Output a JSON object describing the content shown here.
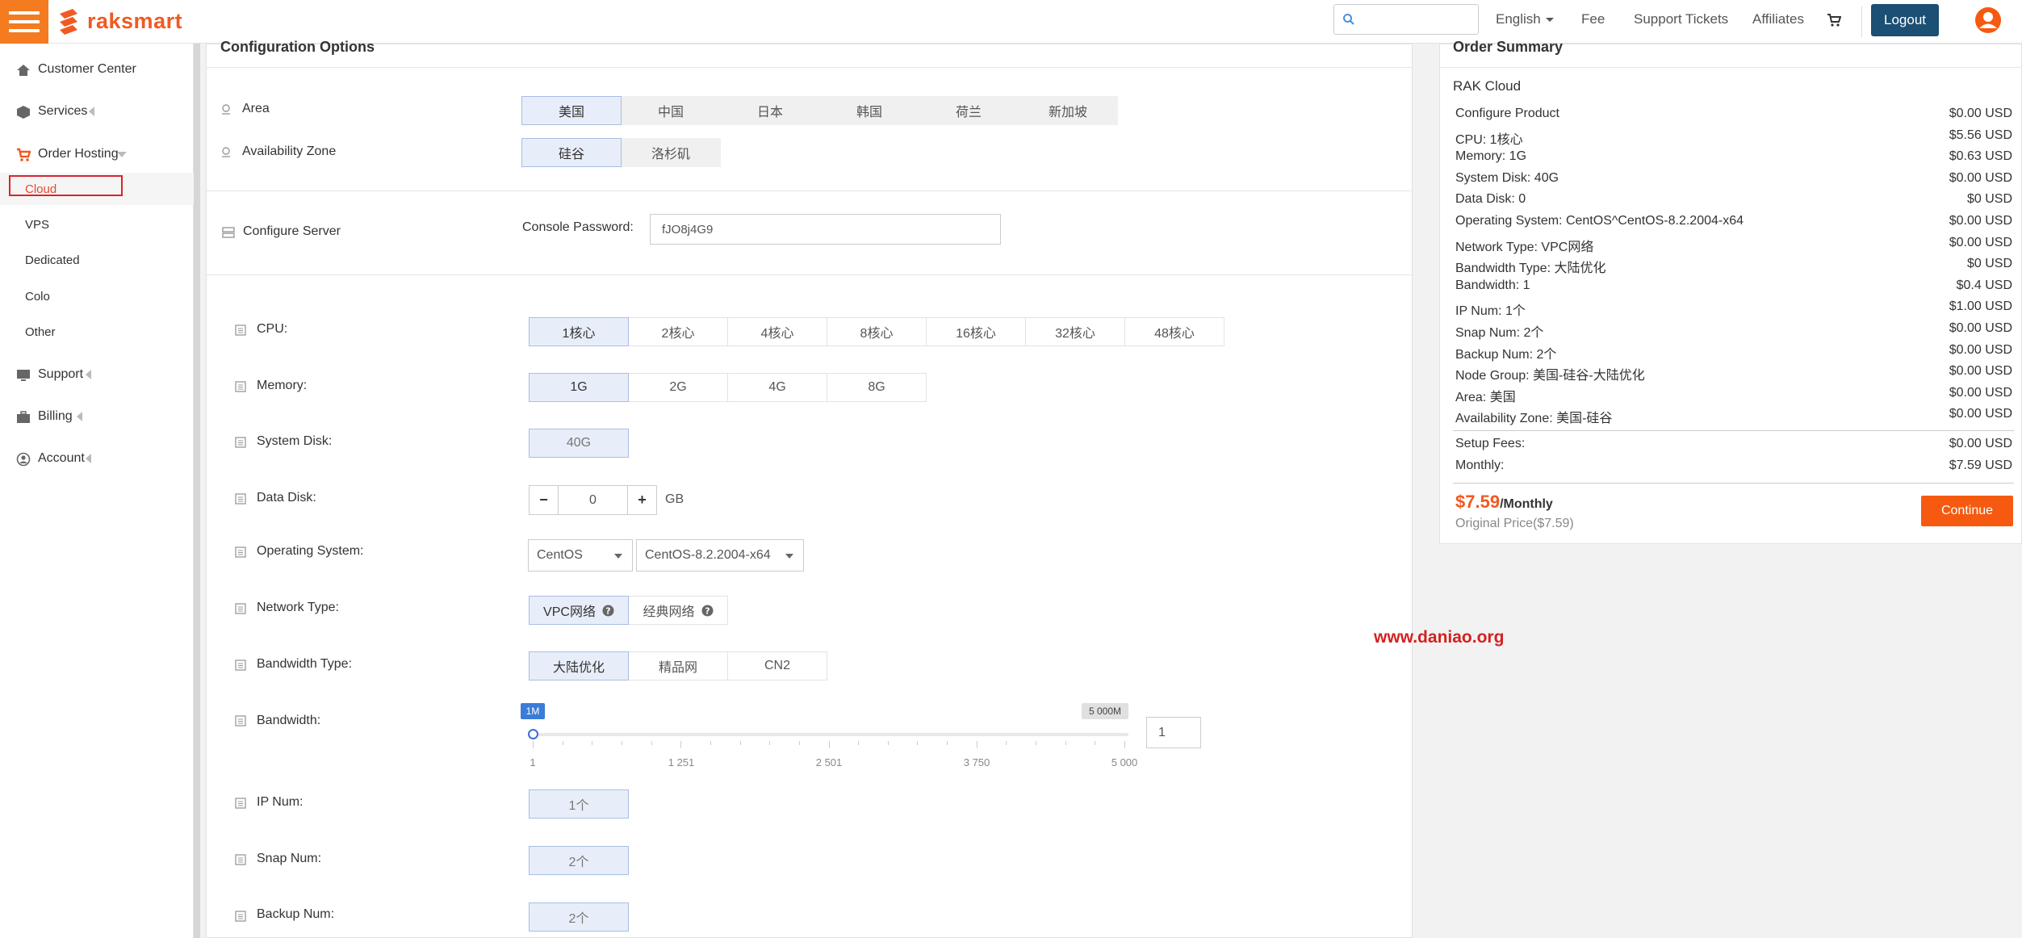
{
  "header": {
    "brand": "raksmart",
    "search_placeholder": "",
    "language": "English",
    "links": [
      "Fee",
      "Support Tickets",
      "Affiliates"
    ],
    "logout": "Logout",
    "colors": {
      "accent": "#f47b20",
      "logout_bg": "#1b4f73",
      "continue_bg": "#f55a10"
    }
  },
  "sidebar": {
    "items": [
      {
        "label": "Customer Center",
        "icon": "home-icon"
      },
      {
        "label": "Services",
        "icon": "cube-icon"
      },
      {
        "label": "Order Hosting",
        "icon": "cart-icon"
      },
      {
        "label": "Support",
        "icon": "monitor-icon"
      },
      {
        "label": "Billing",
        "icon": "briefcase-icon"
      },
      {
        "label": "Account",
        "icon": "user-circle-icon"
      }
    ],
    "sub_items": [
      "Cloud",
      "VPS",
      "Dedicated",
      "Colo",
      "Other"
    ]
  },
  "config": {
    "title": "Configuration Options",
    "area": {
      "label": "Area",
      "options": [
        "美国",
        "中国",
        "日本",
        "韩国",
        "荷兰",
        "新加坡"
      ],
      "selected": 0
    },
    "zone": {
      "label": "Availability Zone",
      "options": [
        "硅谷",
        "洛杉矶"
      ],
      "selected": 0
    },
    "server": {
      "label": "Configure Server",
      "password_label": "Console Password:",
      "password_value": "fJO8j4G9"
    },
    "cpu": {
      "label": "CPU:",
      "options": [
        "1核心",
        "2核心",
        "4核心",
        "8核心",
        "16核心",
        "32核心",
        "48核心"
      ],
      "selected": 0
    },
    "memory": {
      "label": "Memory:",
      "options": [
        "1G",
        "2G",
        "4G",
        "8G"
      ],
      "selected": 0
    },
    "system_disk": {
      "label": "System Disk:",
      "value": "40G"
    },
    "data_disk": {
      "label": "Data Disk:",
      "minus": "−",
      "value": "0",
      "plus": "+",
      "unit": "GB"
    },
    "os": {
      "label": "Operating System:",
      "family": "CentOS",
      "version": "CentOS-8.2.2004-x64"
    },
    "network": {
      "label": "Network Type:",
      "options": [
        "VPC网络",
        "经典网络"
      ],
      "selected": 0
    },
    "bandwidth_type": {
      "label": "Bandwidth Type:",
      "options": [
        "大陆优化",
        "精品网",
        "CN2"
      ],
      "selected": 0
    },
    "bandwidth": {
      "label": "Bandwidth:",
      "min_tag": "1M",
      "max_tag": "5 000M",
      "ticks": [
        "1",
        "1 251",
        "2 501",
        "3 750",
        "5 000"
      ],
      "value": 1,
      "min": 1,
      "max": 5000,
      "input_value": "1"
    },
    "ip_num": {
      "label": "IP Num:",
      "value": "1个"
    },
    "snap_num": {
      "label": "Snap Num:",
      "value": "2个"
    },
    "backup_num": {
      "label": "Backup Num:",
      "value": "2个"
    }
  },
  "watermark": "www.daniao.org",
  "summary": {
    "title": "Order Summary",
    "product": "RAK Cloud",
    "rows": [
      {
        "k": "Configure Product",
        "v": "$0.00 USD"
      },
      {
        "k": "CPU: 1核心",
        "v": "$5.56 USD"
      },
      {
        "k": "Memory: 1G",
        "v": "$0.63 USD"
      },
      {
        "k": "System Disk: 40G",
        "v": "$0.00 USD"
      },
      {
        "k": "Data Disk: 0",
        "v": "$0 USD"
      },
      {
        "k": "Operating System: CentOS^CentOS-8.2.2004-x64",
        "v": "$0.00 USD"
      },
      {
        "k": "Network Type: VPC网络",
        "v": "$0.00 USD"
      },
      {
        "k": "Bandwidth Type: 大陆优化",
        "v": "$0 USD"
      },
      {
        "k": "Bandwidth: 1",
        "v": "$0.4 USD"
      },
      {
        "k": "IP Num: 1个",
        "v": "$1.00 USD"
      },
      {
        "k": "Snap Num: 2个",
        "v": "$0.00 USD"
      },
      {
        "k": "Backup Num: 2个",
        "v": "$0.00 USD"
      },
      {
        "k": "Node Group: 美国-硅谷-大陆优化",
        "v": "$0.00 USD"
      },
      {
        "k": "Area: 美国",
        "v": "$0.00 USD"
      },
      {
        "k": "Availability Zone: 美国-硅谷",
        "v": "$0.00 USD"
      }
    ],
    "fees": [
      {
        "k": "Setup Fees:",
        "v": "$0.00 USD"
      },
      {
        "k": "Monthly:",
        "v": "$7.59 USD"
      }
    ],
    "price": "$7.59",
    "per": "/Monthly",
    "original": "Original Price($7.59)",
    "continue": "Continue"
  }
}
